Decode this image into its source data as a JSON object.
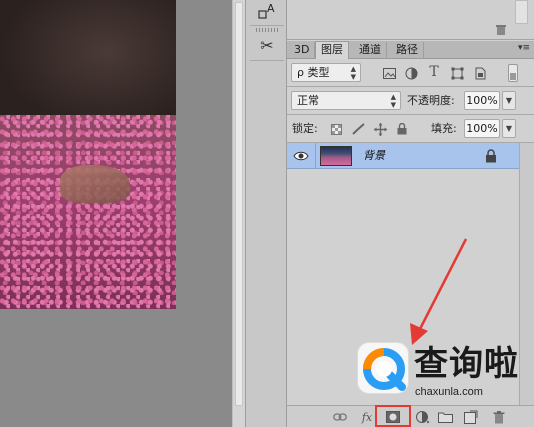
{
  "tool_column": {
    "tools": [
      {
        "icon": "character-panel-icon",
        "glyph": "A"
      },
      {
        "icon": "tool-presets-icon",
        "glyph": "✂"
      }
    ]
  },
  "panel": {
    "tabs": [
      {
        "label": "3D",
        "active": false
      },
      {
        "label": "图层",
        "active": true
      },
      {
        "label": "通道",
        "active": false
      },
      {
        "label": "路径",
        "active": false
      }
    ],
    "menu_glyph": "▾≡",
    "filter": {
      "kind_label": "ρ 类型",
      "icons": [
        "pixel-filter-icon",
        "adjustment-filter-icon",
        "type-filter-icon",
        "shape-filter-icon",
        "smart-object-filter-icon",
        "filter-toggle-icon"
      ]
    },
    "blend": {
      "mode": "正常",
      "opacity_label": "不透明度:",
      "opacity_value": "100%"
    },
    "lock": {
      "label": "锁定:",
      "icons": [
        "lock-transparent-icon",
        "lock-image-icon",
        "lock-position-icon",
        "lock-all-icon"
      ],
      "fill_label": "填充:",
      "fill_value": "100%"
    },
    "layers": [
      {
        "name": "背景",
        "visible": true,
        "locked": true,
        "selected": true
      }
    ],
    "bottom_icons": [
      "link-layers-icon",
      "fx-icon",
      "add-mask-icon",
      "adjustment-layer-icon",
      "group-icon",
      "new-layer-icon",
      "delete-layer-icon"
    ],
    "bottom_fx_label": "fx"
  },
  "annotation": {
    "highlight_color": "#e53935"
  },
  "watermark": {
    "title": "查询啦",
    "subtitle": "chaxunla.com"
  }
}
